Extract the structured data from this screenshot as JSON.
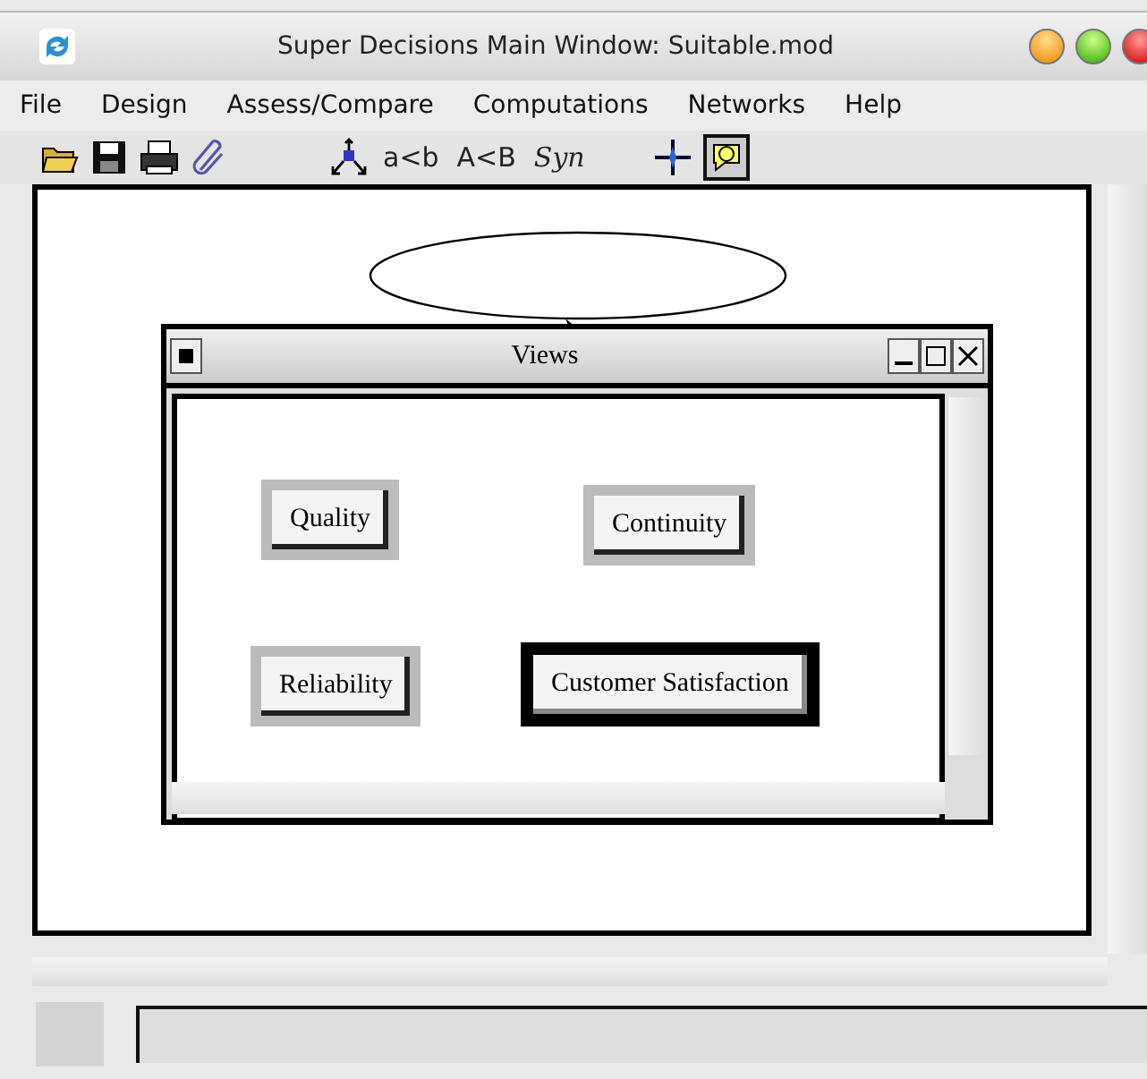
{
  "window": {
    "title": "Super Decisions Main Window: Suitable.mod"
  },
  "menu": [
    "File",
    "Design",
    "Assess/Compare",
    "Computations",
    "Networks",
    "Help"
  ],
  "toolbar": {
    "text_buttons": [
      {
        "label": "a<b",
        "kind": "plain"
      },
      {
        "label": "A<B",
        "kind": "plain"
      },
      {
        "label": "Syn",
        "kind": "script"
      }
    ],
    "help_pressed": true
  },
  "views_window": {
    "title": "Views",
    "nodes": [
      {
        "label": "Quality",
        "selected": false
      },
      {
        "label": "Continuity",
        "selected": false
      },
      {
        "label": "Reliability",
        "selected": false
      },
      {
        "label": "Customer Satisfaction",
        "selected": true
      }
    ]
  }
}
